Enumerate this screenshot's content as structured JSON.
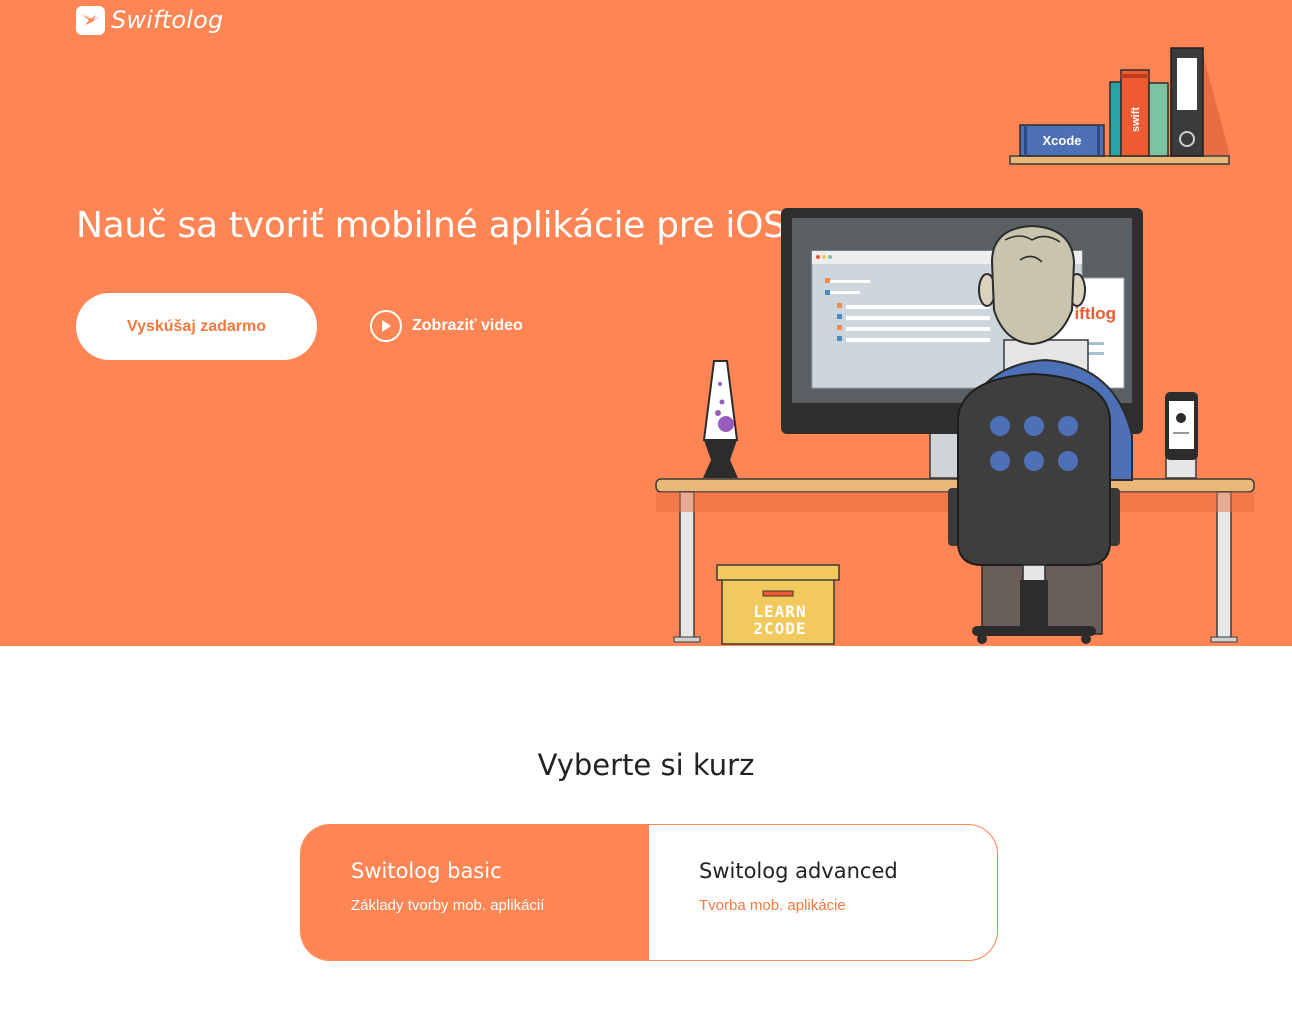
{
  "brand": {
    "name": "Swiftolog"
  },
  "hero": {
    "headline": "Nauč sa tvoriť mobilné aplikácie pre iOS",
    "cta_label": "Vyskúšaj zadarmo",
    "video_label": "Zobraziť video"
  },
  "illustration": {
    "book_xcode": "Xcode",
    "book_swift": "swift",
    "screen_brand": "iftlog",
    "box_text_1": "LEARN",
    "box_text_2": "2CODE"
  },
  "courses": {
    "title": "Vyberte si kurz",
    "items": [
      {
        "name": "Switolog basic",
        "description": "Základy tvorby mob. aplikácií"
      },
      {
        "name": "Switolog advanced",
        "description": "Tvorba mob. aplikácie"
      }
    ]
  },
  "colors": {
    "accent": "#ff8555",
    "accent_text": "#f5793f",
    "text_dark": "#222222"
  }
}
